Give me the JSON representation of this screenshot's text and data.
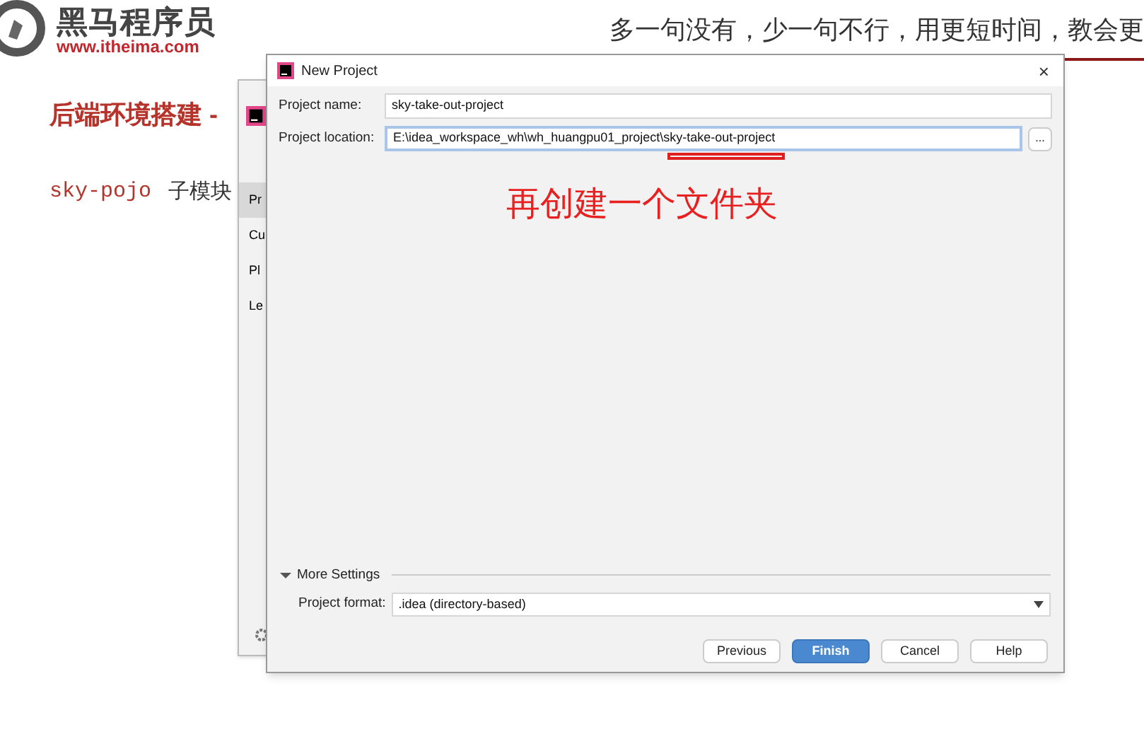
{
  "slide": {
    "logo": {
      "name": "黑马程序员",
      "url": "www.itheima.com"
    },
    "tagline": "多一句没有，少一句不行，用更短时间，教会更",
    "heading": "后端环境搭建 -",
    "code": "sky-pojo",
    "text": "子模块"
  },
  "back_dialog": {
    "items": [
      {
        "label": "Pr",
        "selected": true
      },
      {
        "label": "Cu",
        "selected": false
      },
      {
        "label": "Pl",
        "selected": false
      },
      {
        "label": "Le",
        "selected": false
      }
    ]
  },
  "dialog": {
    "title": "New Project",
    "close": "×",
    "fields": [
      {
        "label": "Project name:",
        "value": "sky-take-out-project",
        "focused": false
      },
      {
        "label": "Project location:",
        "value": "E:\\idea_workspace_wh\\wh_huangpu01_project\\sky-take-out-project",
        "focused": true,
        "browse": "..."
      }
    ],
    "annotation": "再创建一个文件夹",
    "more_settings": {
      "label": "More Settings",
      "expanded": true,
      "format_label": "Project format:",
      "format_value": ".idea (directory-based)"
    },
    "buttons": [
      {
        "label": "Previous",
        "primary": false
      },
      {
        "label": "Finish",
        "primary": true
      },
      {
        "label": "Cancel",
        "primary": false
      },
      {
        "label": "Help",
        "primary": false
      }
    ]
  }
}
